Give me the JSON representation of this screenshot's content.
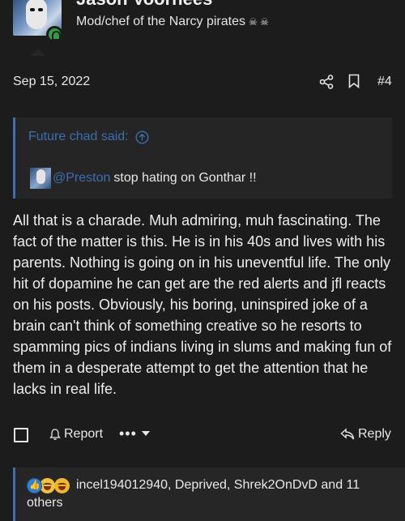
{
  "user": {
    "name": "Jason Voorhees",
    "title": "Mod/chef of the Narcy pirates",
    "title_emoji": "☠ ☠"
  },
  "post": {
    "date": "Sep 15, 2022",
    "number": "#4",
    "quote": {
      "attribution": "Future chad said:",
      "mention": "@Preston",
      "text": "stop hating on Gonthar !!"
    },
    "body": "All that is a charade. Muh admiring, muh fascinating. The fact of the matter is this. He is in his 40s and lives with his parents. Nothing is going on in his uneventful life. The only hit of dopamine he can get are the red alerts and jfl reacts on his posts. Obviously, his boring, uninspired joke of a brain can't think of something creative so he resorts to spamming pics of indians living in slums and making fun of them in a desperate attempt to get the attention that he lacks in real life."
  },
  "actions": {
    "report_label": "Report",
    "more_label": "•••",
    "reply_label": "Reply"
  },
  "reactions": {
    "icons": [
      "like-icon",
      "laugh-icon",
      "thinking-icon"
    ],
    "text_line1": "incel194012940, Deprived, Shrek2OnDvD and 11",
    "text_line2": "others"
  },
  "colors": {
    "background": "#1c1c1c",
    "accent": "#3b6fb0",
    "online": "#2f9e44"
  }
}
